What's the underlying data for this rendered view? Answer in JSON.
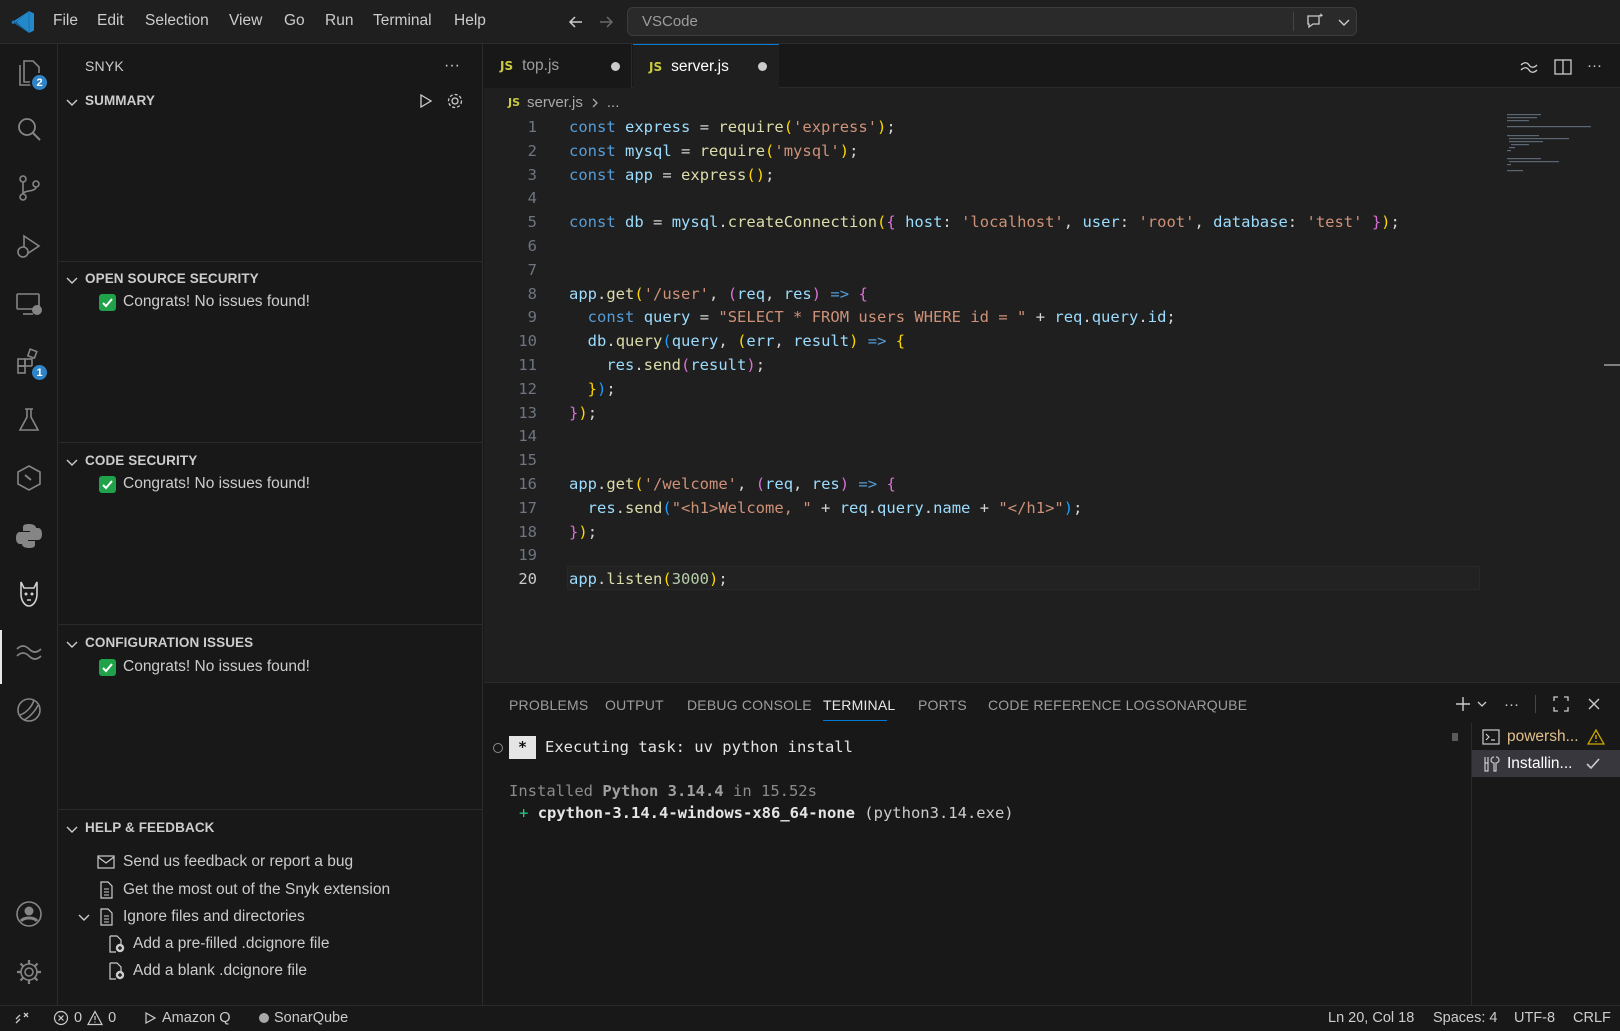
{
  "menu": [
    "File",
    "Edit",
    "Selection",
    "View",
    "Go",
    "Run",
    "Terminal",
    "Help"
  ],
  "command_center": "VSCode",
  "activity_badges": {
    "explorer": "2",
    "extensions": "1"
  },
  "sidebar": {
    "title": "SNYK",
    "sections": {
      "summary": "SUMMARY",
      "oss": "OPEN SOURCE SECURITY",
      "code": "CODE SECURITY",
      "config": "CONFIGURATION ISSUES",
      "help": "HELP & FEEDBACK"
    },
    "no_issues": "Congrats! No issues found!",
    "help_items": {
      "feedback": "Send us feedback or report a bug",
      "most": "Get the most out of the Snyk extension",
      "ignore": "Ignore files and directories",
      "prefilled": "Add a pre-filled .dcignore file",
      "blank": "Add a blank .dcignore file"
    }
  },
  "tabs": {
    "top": "top.js",
    "server": "server.js",
    "js_badge": "JS"
  },
  "breadcrumb": {
    "file": "server.js",
    "rest": "..."
  },
  "code": {
    "line_numbers": [
      "1",
      "2",
      "3",
      "4",
      "5",
      "6",
      "7",
      "8",
      "9",
      "10",
      "11",
      "12",
      "13",
      "14",
      "15",
      "16",
      "17",
      "18",
      "19",
      "20"
    ],
    "lines": [
      "const express = require('express');",
      "const mysql = require('mysql');",
      "const app = express();",
      "",
      "const db = mysql.createConnection({ host: 'localhost', user: 'root', database: 'test' });",
      "",
      "",
      "app.get('/user', (req, res) => {",
      "  const query = \"SELECT * FROM users WHERE id = \" + req.query.id;",
      "  db.query(query, (err, result) => {",
      "    res.send(result);",
      "  });",
      "});",
      "",
      "",
      "app.get('/welcome', (req, res) => {",
      "  res.send(\"<h1>Welcome, \" + req.query.name + \"</h1>\");",
      "});",
      "",
      "app.listen(3000);"
    ]
  },
  "panel": {
    "tabs": [
      "PROBLEMS",
      "OUTPUT",
      "DEBUG CONSOLE",
      "TERMINAL",
      "PORTS",
      "CODE REFERENCE LOG",
      "SONARQUBE"
    ],
    "terminal": {
      "task_badge": "*",
      "task": "Executing task: uv python install",
      "installed_pre": "Installed ",
      "installed_ver": "Python 3.14.4",
      "installed_post": " in 15.52s",
      "plus": "+",
      "pkg": "cpython-3.14.4-windows-x86_64-none",
      "pkg_exe": " (python3.14.exe)"
    },
    "term_list": {
      "powershell": "powersh...",
      "installing": "Installin..."
    }
  },
  "status": {
    "errors": "0",
    "warnings": "0",
    "amazonq": "Amazon Q",
    "sonarqube": "SonarQube",
    "position": "Ln 20, Col 18",
    "spaces": "Spaces: 4",
    "encoding": "UTF-8",
    "eol": "CRLF"
  }
}
